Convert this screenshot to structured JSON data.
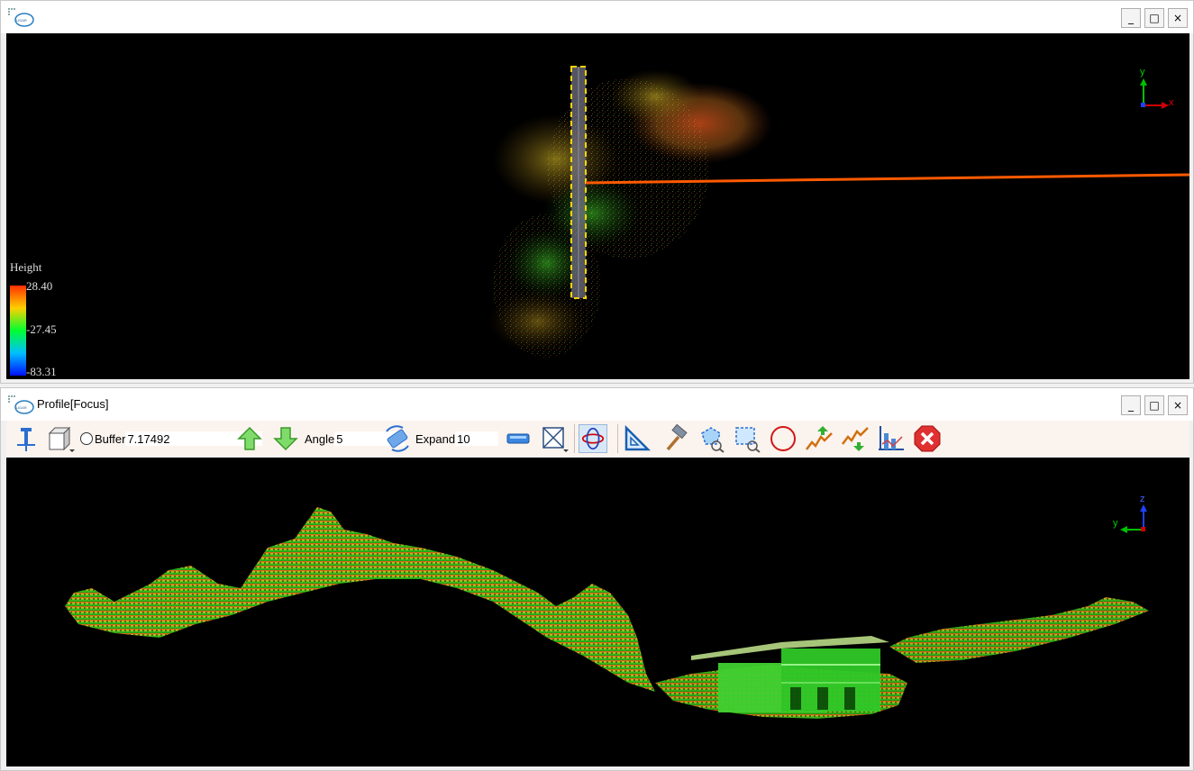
{
  "top_window": {
    "title": "",
    "legend": {
      "title": "Height",
      "max": "28.40",
      "mid": "-27.45",
      "min": "-83.31"
    },
    "axes": {
      "y": "y",
      "x": "x"
    }
  },
  "bottom_window": {
    "title": "Profile[Focus]",
    "axes": {
      "z": "z",
      "y": "y"
    },
    "toolbar": {
      "buffer_label": "Buffer",
      "buffer_value": "7.17492",
      "angle_label": "Angle",
      "angle_value": "5",
      "expand_label": "Expand",
      "expand_value": "10",
      "icons": [
        "pin-icon",
        "cube-view-icon",
        "up-arrow-icon",
        "down-arrow-icon",
        "rotate-icon",
        "rectangle-icon",
        "frame-icon",
        "orbit-icon",
        "ruler-icon",
        "hammer-icon",
        "polygon-select-icon",
        "rect-select-icon",
        "circle-icon",
        "raise-icon",
        "lower-icon",
        "chart-icon",
        "close-red-icon"
      ]
    }
  },
  "window_buttons": {
    "minimize": "_",
    "maximize": "□",
    "close": "×"
  },
  "colors": {
    "accent_line": "#ff5a00",
    "viewport_bg": "#000000",
    "toolbar_bg": "#fbf3ee"
  }
}
